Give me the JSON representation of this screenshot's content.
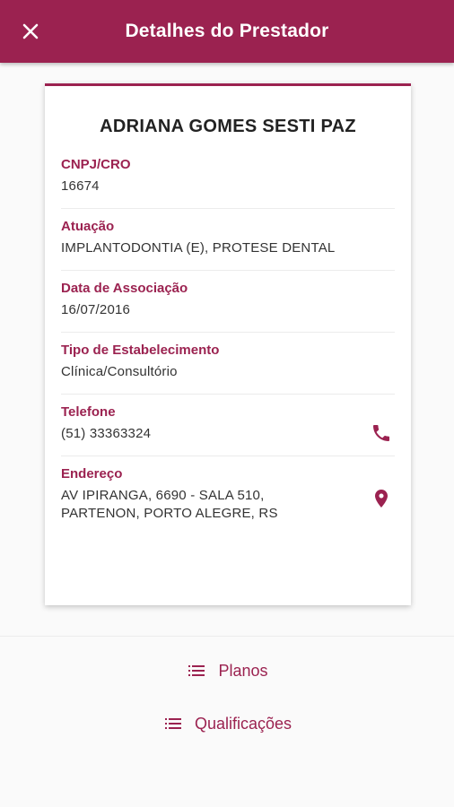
{
  "header": {
    "title": "Detalhes do Prestador",
    "close_icon": "close-icon"
  },
  "provider": {
    "name": "ADRIANA GOMES SESTI PAZ",
    "fields": [
      {
        "label": "CNPJ/CRO",
        "value": "16674"
      },
      {
        "label": "Atuação",
        "value": "IMPLANTODONTIA (E), PROTESE DENTAL"
      },
      {
        "label": "Data de Associação",
        "value": "16/07/2016"
      },
      {
        "label": "Tipo de Estabelecimento",
        "value": "Clínica/Consultório"
      },
      {
        "label": "Telefone",
        "value": "(51) 33363324",
        "icon": "phone-icon"
      },
      {
        "label": "Endereço",
        "value_line1": "AV IPIRANGA, 6690 - SALA 510,",
        "value_line2": "PARTENON, PORTO ALEGRE, RS",
        "icon": "location-pin-icon"
      }
    ]
  },
  "actions": {
    "plans_label": "Planos",
    "qualifications_label": "Qualificações",
    "icon": "list-icon"
  },
  "colors": {
    "primary": "#9b2250",
    "background": "#fafafa",
    "card": "#ffffff"
  }
}
